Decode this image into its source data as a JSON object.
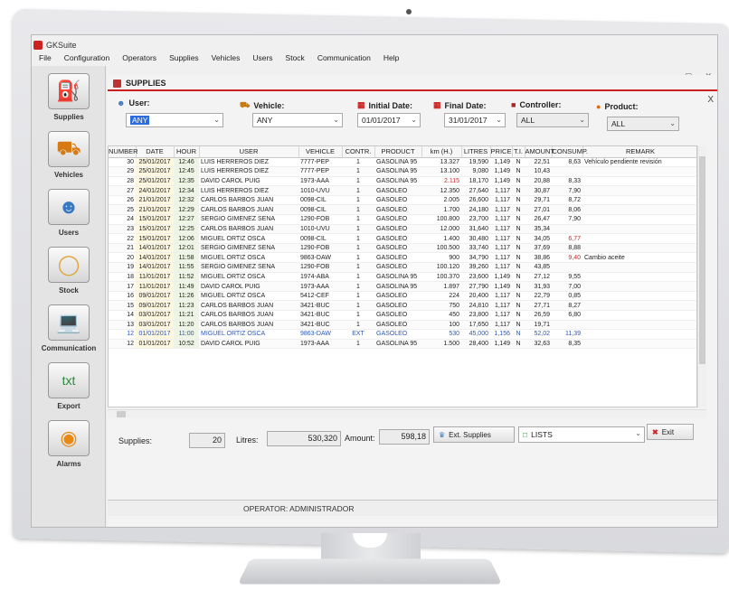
{
  "app": {
    "title": "GKSuite"
  },
  "menu": {
    "items": [
      "File",
      "Configuration",
      "Operators",
      "Supplies",
      "Vehicles",
      "Users",
      "Stock",
      "Communication",
      "Help"
    ]
  },
  "sidebar": {
    "items": [
      {
        "label": "Supplies",
        "icon": "fuel-pump-icon"
      },
      {
        "label": "Vehicles",
        "icon": "truck-icon"
      },
      {
        "label": "Users",
        "icon": "user-icon"
      },
      {
        "label": "Stock",
        "icon": "tank-icon"
      },
      {
        "label": "Communication",
        "icon": "monitor-arrow-icon"
      },
      {
        "label": "Export",
        "icon": "export-txt-icon"
      },
      {
        "label": "Alarms",
        "icon": "alarm-icon"
      }
    ]
  },
  "window": {
    "title": "SUPPLIES",
    "close": "X",
    "controls": [
      "–",
      "▢",
      "✕"
    ]
  },
  "filters": {
    "user": {
      "label": "User:",
      "value": "ANY"
    },
    "vehicle": {
      "label": "Vehicle:",
      "value": "ANY"
    },
    "initial_date": {
      "label": "Initial Date:",
      "value": "01/01/2017"
    },
    "final_date": {
      "label": "Final Date:",
      "value": "31/01/2017"
    },
    "controller": {
      "label": "Controller:",
      "value": "ALL"
    },
    "product": {
      "label": "Product:",
      "value": "ALL"
    }
  },
  "table": {
    "columns": [
      "NUMBER",
      "DATE",
      "HOUR",
      "USER",
      "VEHICLE",
      "CONTR.",
      "PRODUCT",
      "km (H.)",
      "LITRES",
      "PRICE",
      "T.I.",
      "AMOUNT",
      "CONSUMP.",
      "REMARK"
    ],
    "rows": [
      [
        "30",
        "25/01/2017",
        "12:46",
        "LUIS HERREROS DIEZ",
        "7777-PEP",
        "1",
        "GASOLINA 95",
        "13.327",
        "19,590",
        "1,149",
        "N",
        "22,51",
        "8,63",
        "Vehículo pendiente revisión"
      ],
      [
        "29",
        "25/01/2017",
        "12:45",
        "LUIS HERREROS DIEZ",
        "7777-PEP",
        "1",
        "GASOLINA 95",
        "13.100",
        "9,080",
        "1,149",
        "N",
        "10,43",
        "",
        ""
      ],
      [
        "28",
        "25/01/2017",
        "12:35",
        "DAVID CAROL PUIG",
        "1973-AAA",
        "1",
        "GASOLINA 95",
        "2.115",
        "18,170",
        "1,149",
        "N",
        "20,88",
        "8,33",
        ""
      ],
      [
        "27",
        "24/01/2017",
        "12:34",
        "LUIS HERREROS DIEZ",
        "1010-UVU",
        "1",
        "GASOLEO",
        "12.350",
        "27,640",
        "1,117",
        "N",
        "30,87",
        "7,90",
        ""
      ],
      [
        "26",
        "21/01/2017",
        "12:32",
        "CARLOS BARBOS JUAN",
        "0098-CIL",
        "1",
        "GASOLEO",
        "2.005",
        "26,600",
        "1,117",
        "N",
        "29,71",
        "8,72",
        ""
      ],
      [
        "25",
        "21/01/2017",
        "12:29",
        "CARLOS BARBOS JUAN",
        "0098-CIL",
        "1",
        "GASOLEO",
        "1.700",
        "24,180",
        "1,117",
        "N",
        "27,01",
        "8,06",
        ""
      ],
      [
        "24",
        "15/01/2017",
        "12:27",
        "SERGIO GIMENEZ SENA",
        "1290-FOB",
        "1",
        "GASOLEO",
        "100.800",
        "23,700",
        "1,117",
        "N",
        "26,47",
        "7,90",
        ""
      ],
      [
        "23",
        "15/01/2017",
        "12:25",
        "CARLOS BARBOS JUAN",
        "1010-UVU",
        "1",
        "GASOLEO",
        "12.000",
        "31,640",
        "1,117",
        "N",
        "35,34",
        "",
        ""
      ],
      [
        "22",
        "15/01/2017",
        "12:06",
        "MIGUEL ORTIZ OSCA",
        "0098-CIL",
        "1",
        "GASOLEO",
        "1.400",
        "30,480",
        "1,117",
        "N",
        "34,05",
        "6,77",
        ""
      ],
      [
        "21",
        "14/01/2017",
        "12:01",
        "SERGIO GIMENEZ SENA",
        "1290-FOB",
        "1",
        "GASOLEO",
        "100.500",
        "33,740",
        "1,117",
        "N",
        "37,69",
        "8,88",
        ""
      ],
      [
        "20",
        "14/01/2017",
        "11:58",
        "MIGUEL ORTIZ OSCA",
        "9863-DAW",
        "1",
        "GASOLEO",
        "900",
        "34,790",
        "1,117",
        "N",
        "38,86",
        "9,40",
        "Cambio aceite"
      ],
      [
        "19",
        "14/01/2017",
        "11:55",
        "SERGIO GIMENEZ SENA",
        "1290-FOB",
        "1",
        "GASOLEO",
        "100.120",
        "39,260",
        "1,117",
        "N",
        "43,85",
        "",
        ""
      ],
      [
        "18",
        "11/01/2017",
        "11:52",
        "MIGUEL ORTIZ OSCA",
        "1974-ABA",
        "1",
        "GASOLINA 95",
        "100.370",
        "23,600",
        "1,149",
        "N",
        "27,12",
        "9,55",
        ""
      ],
      [
        "17",
        "11/01/2017",
        "11:49",
        "DAVID CAROL PUIG",
        "1973-AAA",
        "1",
        "GASOLINA 95",
        "1.897",
        "27,790",
        "1,149",
        "N",
        "31,93",
        "7,00",
        ""
      ],
      [
        "16",
        "09/01/2017",
        "11:26",
        "MIGUEL ORTIZ OSCA",
        "5412-CEF",
        "1",
        "GASOLEO",
        "224",
        "20,400",
        "1,117",
        "N",
        "22,79",
        "0,85",
        ""
      ],
      [
        "15",
        "09/01/2017",
        "11:23",
        "CARLOS BARBOS JUAN",
        "3421-BUC",
        "1",
        "GASOLEO",
        "750",
        "24,810",
        "1,117",
        "N",
        "27,71",
        "8,27",
        ""
      ],
      [
        "14",
        "03/01/2017",
        "11:21",
        "CARLOS BARBOS JUAN",
        "3421-BUC",
        "1",
        "GASOLEO",
        "450",
        "23,800",
        "1,117",
        "N",
        "26,59",
        "6,80",
        ""
      ],
      [
        "13",
        "03/01/2017",
        "11:20",
        "CARLOS BARBOS JUAN",
        "3421-BUC",
        "1",
        "GASOLEO",
        "100",
        "17,650",
        "1,117",
        "N",
        "19,71",
        "",
        ""
      ],
      [
        "12",
        "01/01/2017",
        "11:00",
        "MIGUEL ORTIZ OSCA",
        "9863-DAW",
        "EXT",
        "GASOLEO",
        "530",
        "45,000",
        "1,156",
        "N",
        "52,02",
        "11,39",
        ""
      ],
      [
        "12",
        "01/01/2017",
        "10:52",
        "DAVID CAROL PUIG",
        "1973-AAA",
        "1",
        "GASOLINA 95",
        "1.500",
        "28,400",
        "1,149",
        "N",
        "32,63",
        "8,35",
        ""
      ]
    ]
  },
  "footer": {
    "supplies_label": "Supplies:",
    "supplies_value": "20",
    "litres_label": "Litres:",
    "litres_value": "530,320",
    "amount_label": "Amount:",
    "amount_value": "598,18",
    "ext_supplies": "Ext. Supplies",
    "lists": "LISTS",
    "exit": "Exit"
  },
  "status": {
    "operator": "OPERATOR: ADMINISTRADOR"
  },
  "colors": {
    "accent_red": "#cc1f1f",
    "highlight_blue": "#2a58b8"
  }
}
